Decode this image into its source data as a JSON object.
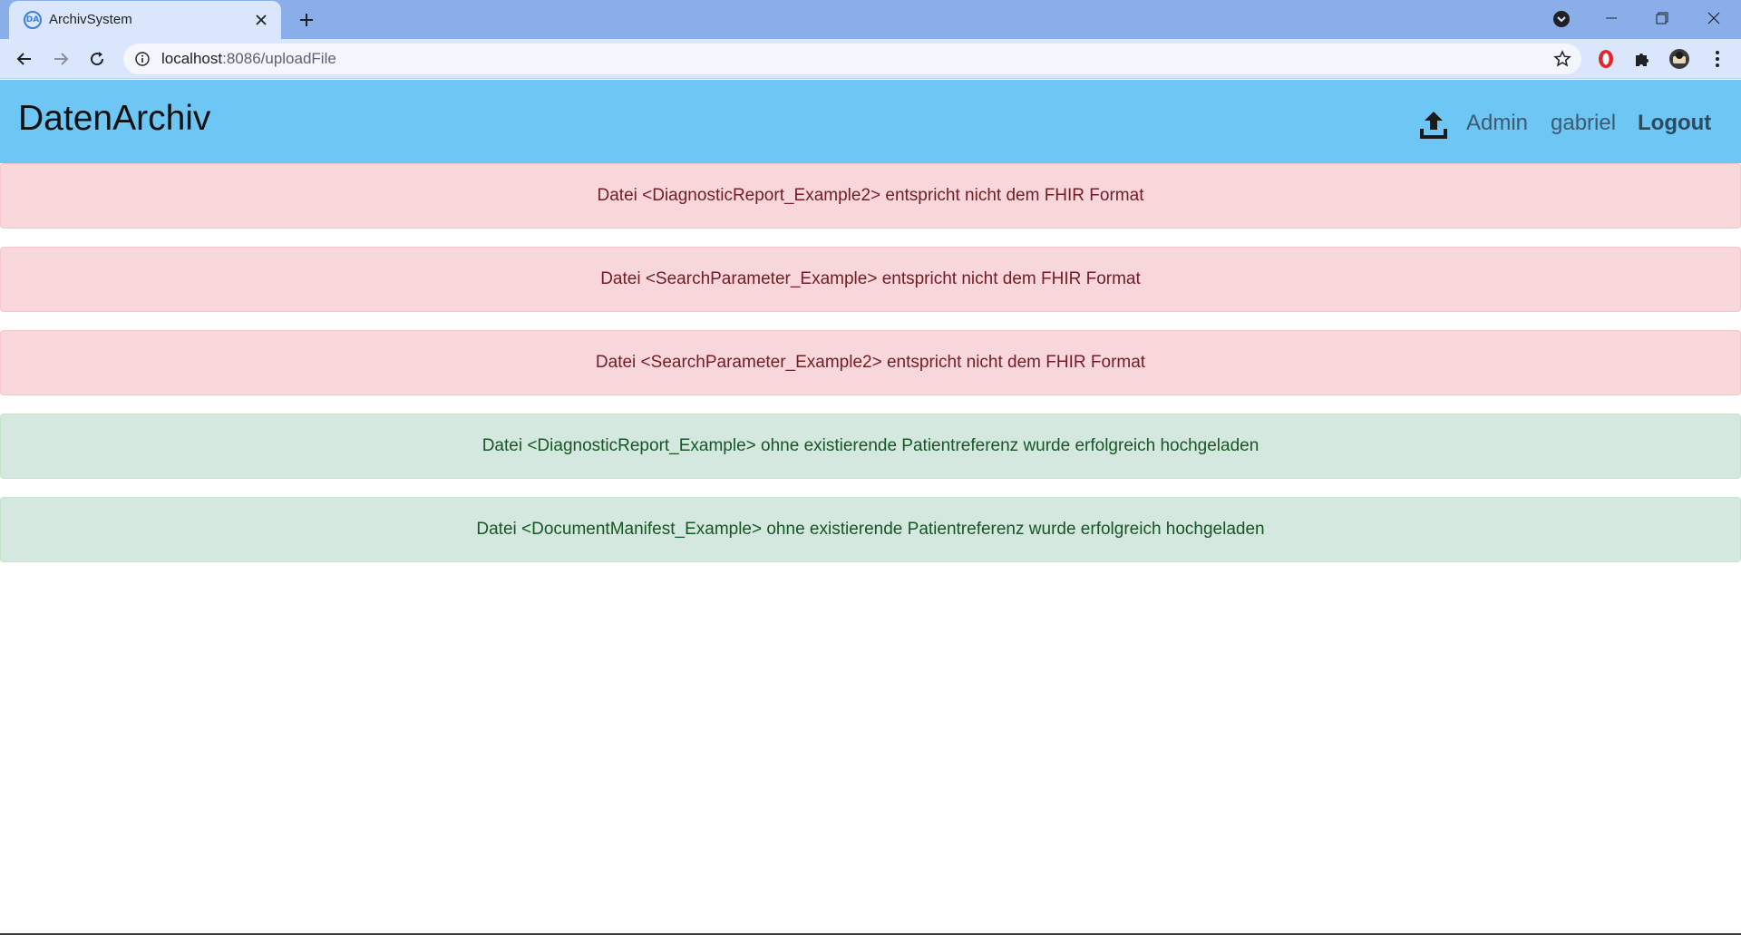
{
  "browser": {
    "tab_title": "ArchivSystem",
    "url_host": "localhost",
    "url_path": ":8086/uploadFile"
  },
  "navbar": {
    "brand": "DatenArchiv",
    "admin_label": "Admin",
    "user_label": "gabriel",
    "logout_label": "Logout"
  },
  "alerts": [
    {
      "type": "danger",
      "text": "Datei <DiagnosticReport_Example2> entspricht nicht dem FHIR Format"
    },
    {
      "type": "danger",
      "text": "Datei <SearchParameter_Example> entspricht nicht dem FHIR Format"
    },
    {
      "type": "danger",
      "text": "Datei <SearchParameter_Example2> entspricht nicht dem FHIR Format"
    },
    {
      "type": "success",
      "text": "Datei <DiagnosticReport_Example> ohne existierende Patientreferenz wurde erfolgreich hochgeladen"
    },
    {
      "type": "success",
      "text": "Datei <DocumentManifest_Example> ohne existierende Patientreferenz wurde erfolgreich hochgeladen"
    }
  ],
  "colors": {
    "navbar_bg": "#6ec6f5",
    "danger_bg": "#f8d7da",
    "success_bg": "#d4e8df"
  }
}
